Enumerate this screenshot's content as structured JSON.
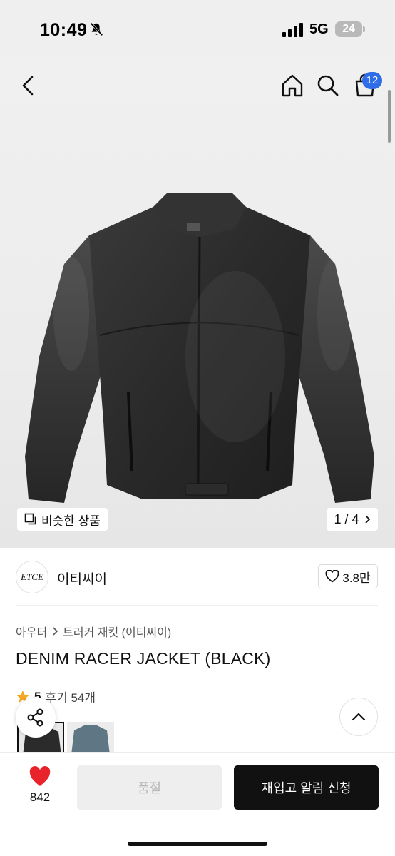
{
  "status_bar": {
    "time": "10:49",
    "network": "5G",
    "battery": "24"
  },
  "nav": {
    "cart_count": "12"
  },
  "gallery": {
    "similar_label": "비슷한 상품",
    "page_counter": "1 / 4"
  },
  "brand": {
    "logo_text": "ETCE",
    "name": "이티씨이",
    "likes": "3.8만"
  },
  "breadcrumb": {
    "category": "아우터",
    "subcategory": "트러커 재킷 (이티씨이)"
  },
  "product": {
    "title": "DENIM RACER JACKET (BLACK)",
    "rating": "5",
    "reviews": "후기 54개"
  },
  "bottom_bar": {
    "like_count": "842",
    "soldout_label": "품절",
    "restock_label": "재입고 알림 신청"
  },
  "colors": {
    "badge": "#2f6de8",
    "star": "#f5a623",
    "heart": "#e8232b",
    "primary_button": "#111111"
  },
  "icons": [
    "bell-slash-icon",
    "signal-icon",
    "back-icon",
    "home-icon",
    "search-icon",
    "cart-icon",
    "similar-icon",
    "chevron-right-icon",
    "heart-outline-icon",
    "star-icon",
    "share-icon",
    "chevron-up-icon",
    "heart-filled-icon"
  ]
}
